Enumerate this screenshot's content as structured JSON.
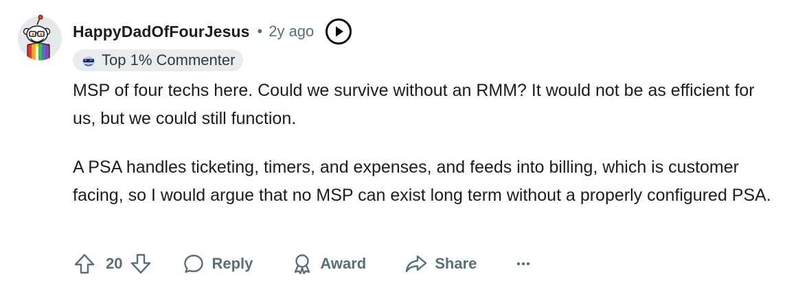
{
  "comment": {
    "author": "HappyDadOfFourJesus",
    "separator": "•",
    "time": "2y ago",
    "flair": {
      "icon": "sunglasses-snoo-icon",
      "text": "Top 1% Commenter"
    },
    "paragraphs": [
      "MSP of four techs here. Could we survive without an RMM? It would not be as efficient for us, but we could still function.",
      "A PSA handles ticketing, timers, and expenses, and feeds into billing, which is customer facing, so I would argue that no MSP can exist long term without a properly configured PSA."
    ],
    "score": "20",
    "actions": {
      "reply": "Reply",
      "award": "Award",
      "share": "Share"
    }
  },
  "colors": {
    "text": "#1c1c1c",
    "meta": "#576f76",
    "flair_bg": "#eaedef"
  }
}
